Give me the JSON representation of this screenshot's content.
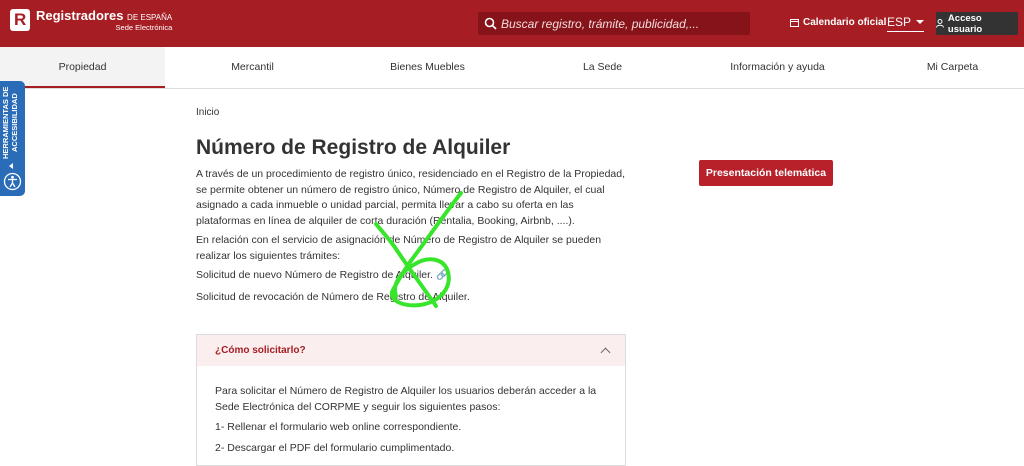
{
  "header": {
    "logo_main": "Registradores",
    "logo_small": "DE ESPAÑA",
    "logo_sub": "Sede Electrónica",
    "search_placeholder": "Buscar registro, trámite, publicidad,...",
    "calendar_label": "Calendario oficial",
    "language": "ESP",
    "login_label": "Acceso usuario",
    "brand_color": "#a61d23"
  },
  "nav": {
    "items": [
      {
        "label": "Propiedad",
        "active": true
      },
      {
        "label": "Mercantil"
      },
      {
        "label": "Bienes Muebles"
      },
      {
        "label": "La Sede"
      },
      {
        "label": "Información y ayuda"
      },
      {
        "label": "Mi Carpeta"
      }
    ]
  },
  "accessibility": {
    "label": "HERRAMIENTAS DE ACCESIBILIDAD"
  },
  "main": {
    "breadcrumb": "Inicio",
    "title": "Número de Registro de Alquiler",
    "intro": "A través de un procedimiento de registro único, residenciado en el Registro de la Propiedad, se permite obtener un número de registro único, Número de Registro de Alquiler, el cual asignado a cada inmueble o unidad parcial, permita llevar a cabo su oferta en las plataformas en línea de alquiler de corta duración (Rentalia, Booking, Airbnb, ....).",
    "services_text": "En relación con el servicio de asignación de Número de Registro de Alquiler se pueden realizar los siguientes trámites:",
    "link_new": "Solicitud de nuevo Número de Registro de Alquiler.",
    "link_revoke": "Solicitud de revocación de Número de Registro de Alquiler.",
    "button_telematica": "Presentación telemática"
  },
  "panel": {
    "title": "¿Cómo solicitarlo?",
    "text": "Para solicitar el Número de Registro de Alquiler los usuarios deberán acceder a la Sede Electrónica del CORPME y seguir los siguientes pasos:",
    "step1": "1- Rellenar el formulario web online correspondiente.",
    "step2": "2- Descargar el PDF del formulario cumplimentado."
  }
}
